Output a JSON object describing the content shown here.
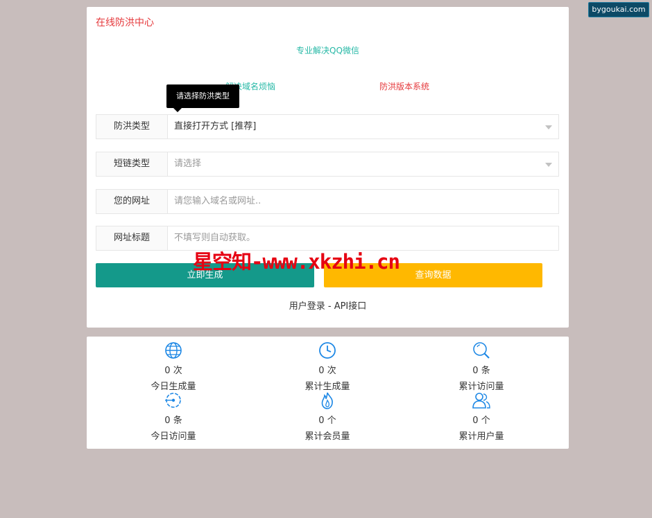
{
  "badge": "bygoukai.com",
  "header": {
    "title": "在线防洪中心",
    "subtitle": "专业解决QQ微信",
    "link_domain": "解决域名烦恼",
    "link_system": "防洪版本系统"
  },
  "tooltip": "请选择防洪类型",
  "form": {
    "type_label": "防洪类型",
    "type_value": "直接打开方式 [推荐]",
    "short_label": "短链类型",
    "short_placeholder": "请选择",
    "url_label": "您的网址",
    "url_placeholder": "请您输入域名或网址..",
    "title_label": "网址标题",
    "title_placeholder": "不填写则自动获取。"
  },
  "buttons": {
    "generate": "立即生成",
    "query": "查询数据"
  },
  "footer_links": "用户登录 - API接口",
  "watermark": "星空知-www.xkzhi.cn",
  "stats": [
    {
      "num": "0 次",
      "label": "今日生成量",
      "icon": "globe-icon"
    },
    {
      "num": "0 次",
      "label": "累计生成量",
      "icon": "clock-icon"
    },
    {
      "num": "0 条",
      "label": "累计访问量",
      "icon": "search-icon"
    },
    {
      "num": "0 条",
      "label": "今日访问量",
      "icon": "target-icon"
    },
    {
      "num": "0 个",
      "label": "累计会员量",
      "icon": "fire-icon"
    },
    {
      "num": "0 个",
      "label": "累计用户量",
      "icon": "users-icon"
    }
  ],
  "colors": {
    "accent_teal": "#14998a",
    "accent_orange": "#ffb800",
    "title_red": "#e5383b",
    "icon_blue": "#1e88e5"
  }
}
